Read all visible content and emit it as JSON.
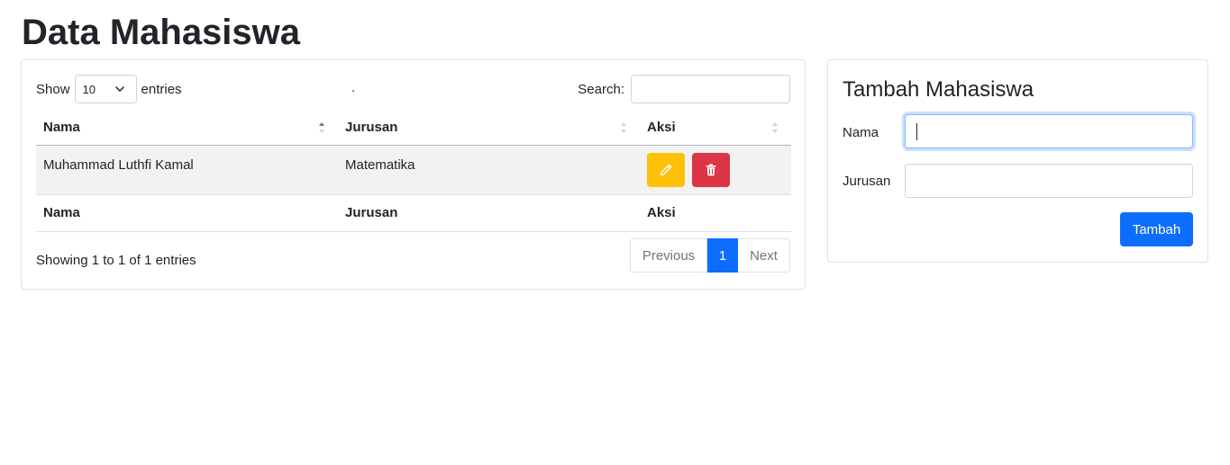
{
  "page": {
    "title": "Data Mahasiswa"
  },
  "table_card": {
    "length_prefix": "Show",
    "length_value": "10",
    "length_suffix": "entries",
    "center_dot": ".",
    "search_label": "Search:",
    "search_value": "",
    "columns": [
      "Nama",
      "Jurusan",
      "Aksi"
    ],
    "rows": [
      {
        "nama": "Muhammad Luthfi Kamal",
        "jurusan": "Matematika"
      }
    ],
    "info": "Showing 1 to 1 of 1 entries",
    "pagination": {
      "previous": "Previous",
      "current": "1",
      "next": "Next"
    }
  },
  "form_card": {
    "title": "Tambah Mahasiswa",
    "nama_label": "Nama",
    "jurusan_label": "Jurusan",
    "submit_label": "Tambah"
  },
  "icons": {
    "length_select": "chevron-down-icon",
    "edit": "pencil-icon",
    "delete": "trash-icon"
  },
  "colors": {
    "primary": "#0d6efd",
    "warning": "#ffc107",
    "danger": "#dc3545"
  }
}
